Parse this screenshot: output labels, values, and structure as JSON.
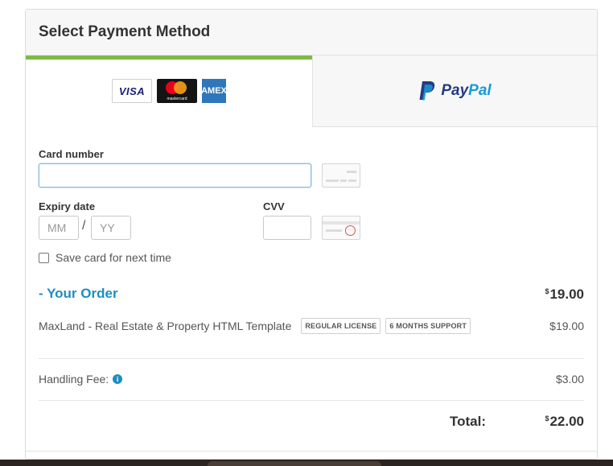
{
  "panel": {
    "title": "Select Payment Method"
  },
  "tabs": {
    "card": {
      "logos": [
        "VISA",
        "mastercard",
        "AMEX"
      ]
    },
    "paypal": {
      "pay": "Pay",
      "pal": "Pal"
    }
  },
  "form": {
    "card_number_label": "Card number",
    "card_number_value": "",
    "expiry_label": "Expiry date",
    "mm_placeholder": "MM",
    "slash": "/",
    "yy_placeholder": "YY",
    "cvv_label": "CVV",
    "cvv_value": "",
    "save_card_label": "Save card for next time",
    "save_card_checked": false
  },
  "order": {
    "title": "- Your Order",
    "currency": "$",
    "total_header": "19.00",
    "item": {
      "name": "MaxLand - Real Estate & Property HTML Template",
      "tags": [
        "REGULAR LICENSE",
        "6 MONTHS SUPPORT"
      ],
      "price": "$19.00"
    },
    "handling_fee_label": "Handling Fee:",
    "handling_fee_value": "$3.00",
    "total_label": "Total:",
    "total_value": "22.00"
  },
  "colors": {
    "accent_green": "#7fba42",
    "accent_blue": "#1f8dc2",
    "paypal_dark": "#253b80",
    "paypal_light": "#179bd7"
  },
  "icons": [
    "info-icon",
    "card-front-icon",
    "card-back-cvv-icon",
    "paypal-logo"
  ]
}
